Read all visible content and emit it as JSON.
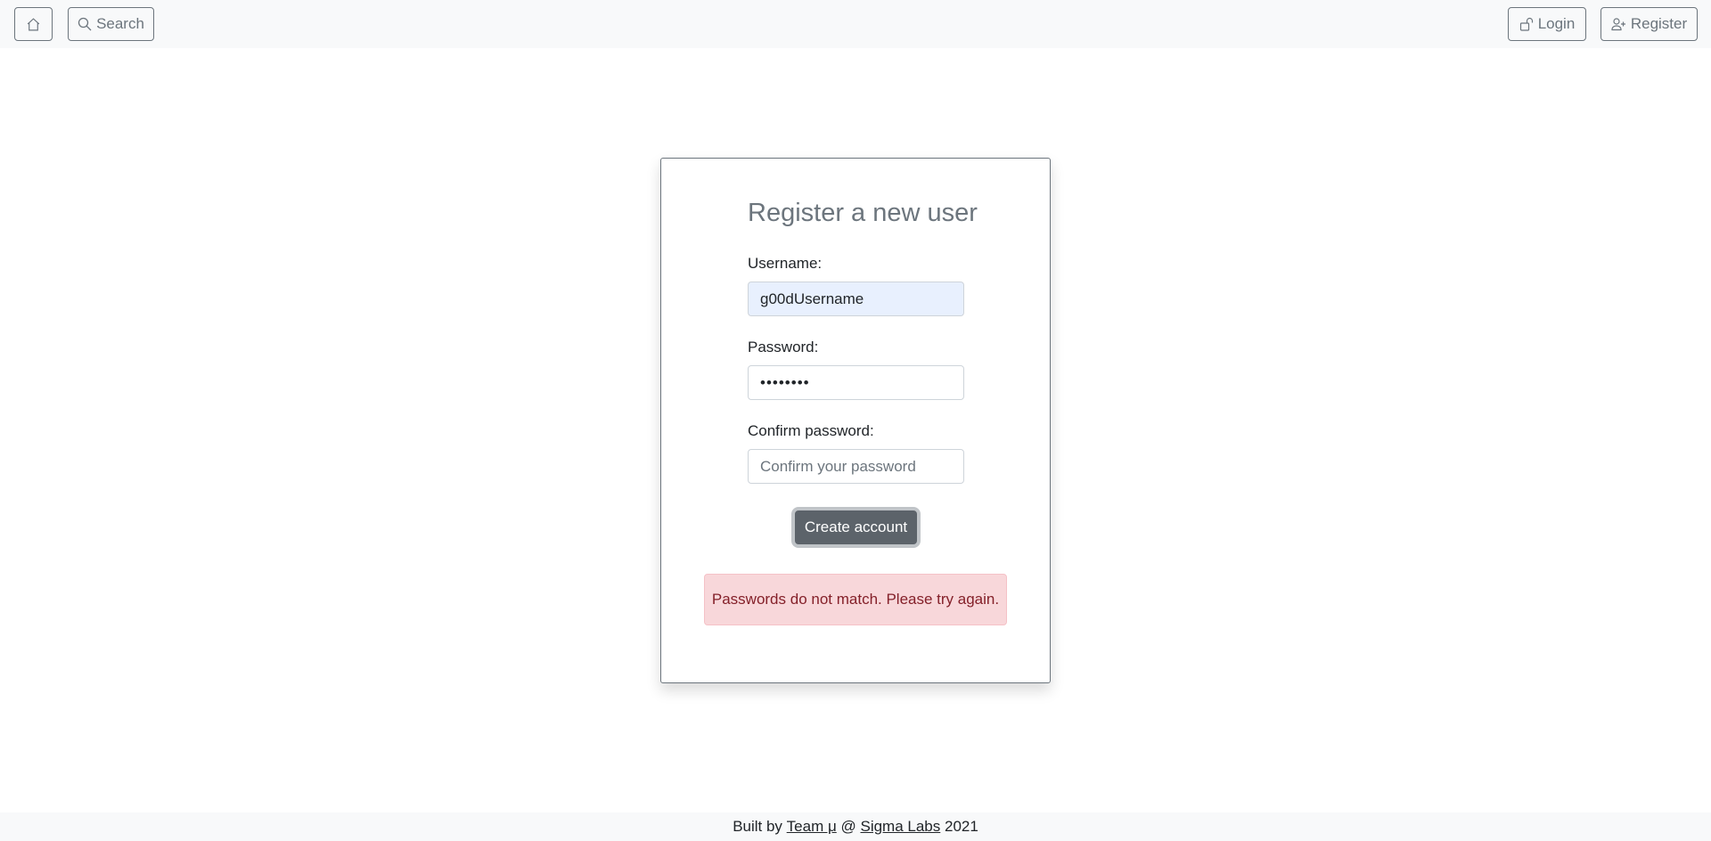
{
  "navbar": {
    "home_icon": "house-icon",
    "search": {
      "label": "Search",
      "icon": "search-icon"
    },
    "login": {
      "label": "Login",
      "icon": "unlock-icon"
    },
    "register": {
      "label": "Register",
      "icon": "person-plus-icon"
    }
  },
  "form": {
    "title": "Register a new user",
    "username": {
      "label": "Username:",
      "value": "g00dUsername"
    },
    "password": {
      "label": "Password:",
      "value": "••••••••"
    },
    "confirm": {
      "label": "Confirm password:",
      "placeholder": "Confirm your password",
      "value": ""
    },
    "submit_label": "Create account",
    "error_message": "Passwords do not match. Please try again."
  },
  "footer": {
    "prefix": "Built by ",
    "team_link": "Team μ",
    "separator": " @ ",
    "org_link": "Sigma Labs",
    "suffix": " 2021"
  },
  "colors": {
    "navbar_bg": "#f8f9fa",
    "outline_secondary": "#6c757d",
    "button_dark": "#5c636a",
    "alert_bg": "#f8d7da",
    "alert_text": "#842029",
    "autofill_bg": "#e8f0fe"
  }
}
